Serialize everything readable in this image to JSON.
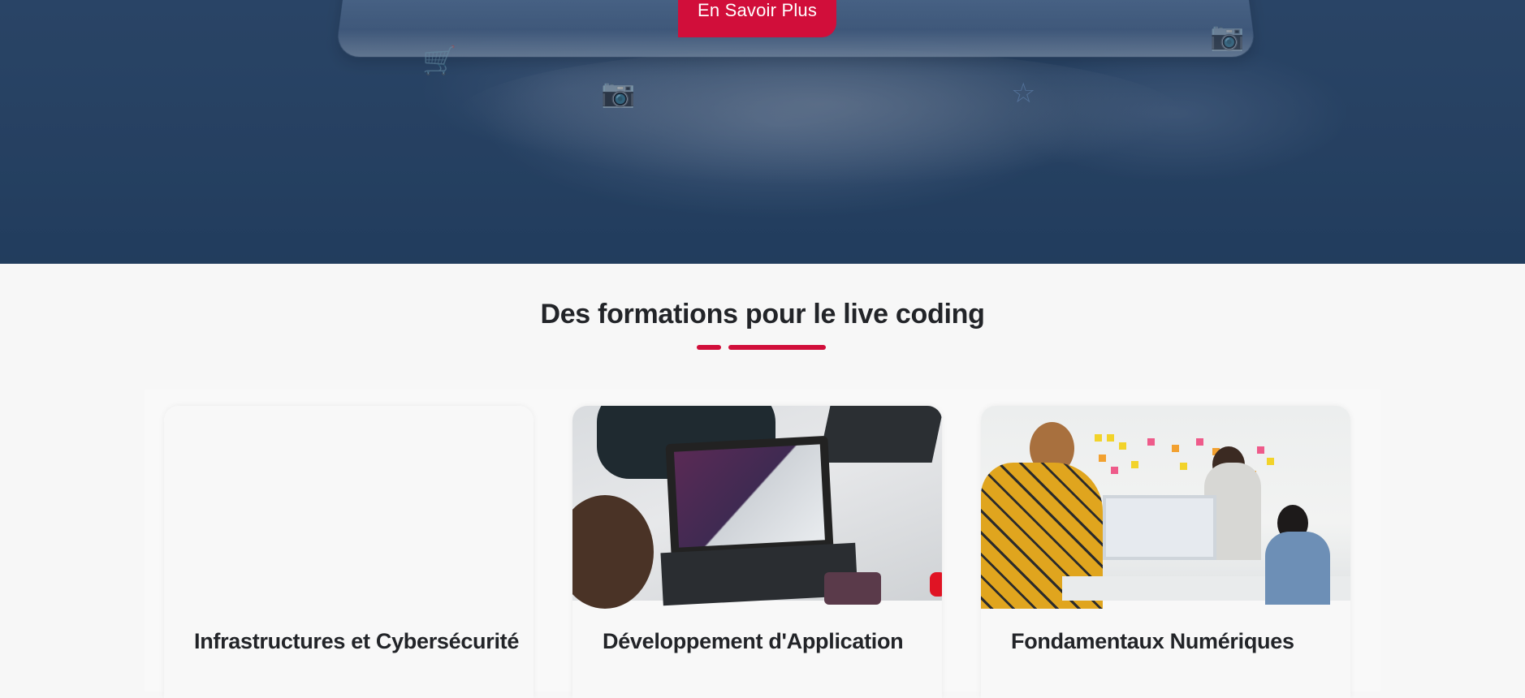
{
  "hero": {
    "button_label": "En Savoir Plus"
  },
  "section": {
    "title": "Des formations pour le live coding"
  },
  "cards": [
    {
      "title": "Infrastructures et Cybersécurité"
    },
    {
      "title": "Développement d'Application"
    },
    {
      "title": "Fondamentaux Numériques"
    }
  ],
  "colors": {
    "accent": "#d10e3a",
    "heading": "#222428",
    "background": "#f7f7f7"
  }
}
